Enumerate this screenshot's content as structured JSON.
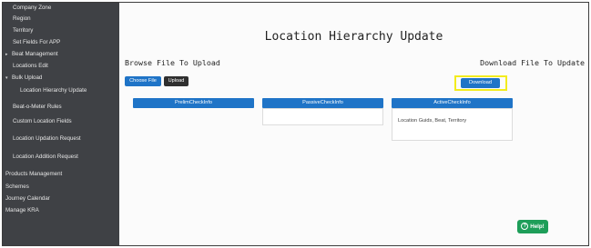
{
  "sidebar": {
    "items": [
      {
        "label": "Company Zone",
        "caret": ""
      },
      {
        "label": "Region",
        "caret": ""
      },
      {
        "label": "Territory",
        "caret": ""
      },
      {
        "label": "Set Fields For APP",
        "caret": ""
      },
      {
        "label": "Beat Management",
        "caret": "▸"
      },
      {
        "label": "Locations Edit",
        "caret": ""
      },
      {
        "label": "Bulk Upload",
        "caret": "▾"
      },
      {
        "label": "Location Hierarchy Update",
        "caret": ""
      },
      {
        "label": "Beat-o-Meter Rules",
        "caret": ""
      },
      {
        "label": "Custom Location Fields",
        "caret": ""
      },
      {
        "label": "Location Updation Request",
        "caret": ""
      },
      {
        "label": "Location Addition Request",
        "caret": ""
      },
      {
        "label": "Products Management",
        "caret": ""
      },
      {
        "label": "Schemes",
        "caret": ""
      },
      {
        "label": "Journey Calendar",
        "caret": ""
      },
      {
        "label": "Manage KRA",
        "caret": ""
      }
    ]
  },
  "main": {
    "title": "Location Hierarchy Update",
    "browse_label": "Browse File To Upload",
    "download_label": "Download File To Update",
    "choose_file": "Choose File",
    "upload": "Upload",
    "download": "Download",
    "columns": [
      {
        "header": "PrelimCheckInfo",
        "content": ""
      },
      {
        "header": "PassiveCheckInfo",
        "content": ""
      },
      {
        "header": "ActiveCheckInfo",
        "content": "Location Guids, Beat, Territory"
      }
    ]
  },
  "help": {
    "label": "Help!",
    "icon": "question-circle-icon"
  },
  "colors": {
    "sidebar_bg": "#3f4145",
    "primary": "#1f74c7",
    "help_green": "#1e9e59",
    "highlight": "#f3ec1d"
  }
}
